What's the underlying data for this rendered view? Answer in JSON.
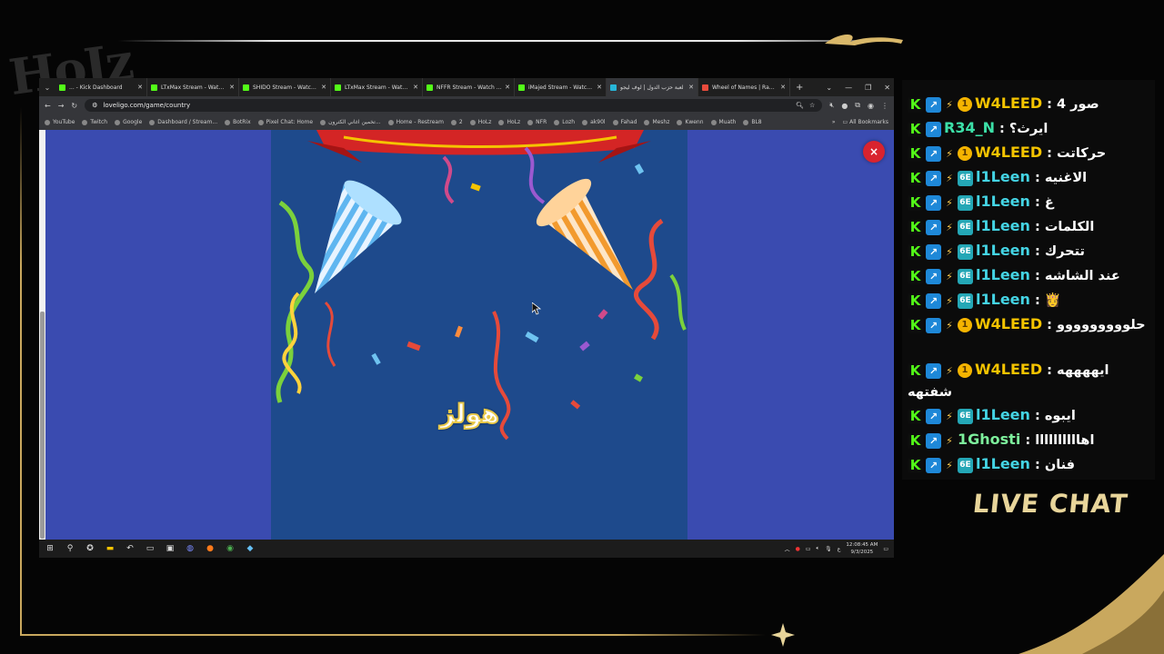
{
  "overlay": {
    "logo_text": "HoIz",
    "live_chat_label": "LIVE CHAT"
  },
  "browser": {
    "tabs": [
      {
        "label": "... - Kick Dashboard",
        "color": "#53fc18"
      },
      {
        "label": "LTxMax Stream - Watch Li",
        "color": "#53fc18"
      },
      {
        "label": "SHIDO Stream - Watch Li",
        "color": "#53fc18"
      },
      {
        "label": "LTxMax Stream - Watch Li",
        "color": "#53fc18"
      },
      {
        "label": "NFFR Stream - Watch Live",
        "color": "#53fc18"
      },
      {
        "label": "iMajed Stream - Watch Li",
        "color": "#53fc18"
      },
      {
        "label": "لعبة حزب الدول | لوف ليجو",
        "color": "#27b6d8",
        "active": true
      },
      {
        "label": "Wheel of Names | Rando",
        "color": "#e94b3c"
      }
    ],
    "url": "loveligo.com/game/country",
    "bookmarks": [
      "YouTube",
      "Twitch",
      "Google",
      "Dashboard / Stream...",
      "BotRix",
      "Pixel Chat: Home",
      "تخمين اغاني الكترون...",
      "Home - Restream",
      "2",
      "HoLz",
      "HoLz",
      "NFR",
      "Lozh",
      "ak90l",
      "Fahad",
      "Meshz",
      "Kwenn",
      "Muath",
      "BL8"
    ],
    "all_bookmarks_label": "All Bookmarks"
  },
  "game": {
    "watermark": "هولز",
    "close_symbol": "×",
    "colors": {
      "sky": "#1e4a8c",
      "side": "#3a4bb0",
      "close": "#d9232e"
    }
  },
  "taskbar": {
    "time": "12:08:45 AM",
    "date": "9/3/2025",
    "lang": "ع"
  },
  "chat": {
    "messages": [
      {
        "user": "W4LEED",
        "badges": [
          "kick",
          "blue",
          "small",
          "coin"
        ],
        "text": "صور 4",
        "ucolor": "#f5c400"
      },
      {
        "user": "R34_N",
        "badges": [
          "kick",
          "blue"
        ],
        "text": "ايرث؟",
        "ucolor": "#3ce0a8"
      },
      {
        "user": "W4LEED",
        "badges": [
          "kick",
          "blue",
          "small",
          "coin"
        ],
        "text": "حركاتت",
        "ucolor": "#f5c400"
      },
      {
        "user": "l1Leen",
        "badges": [
          "kick",
          "blue",
          "small",
          "teal"
        ],
        "text": "الاغنيه",
        "ucolor": "#44d4e4"
      },
      {
        "user": "l1Leen",
        "badges": [
          "kick",
          "blue",
          "small",
          "teal"
        ],
        "text": "غ",
        "ucolor": "#44d4e4"
      },
      {
        "user": "l1Leen",
        "badges": [
          "kick",
          "blue",
          "small",
          "teal"
        ],
        "text": "الكلمات",
        "ucolor": "#44d4e4"
      },
      {
        "user": "l1Leen",
        "badges": [
          "kick",
          "blue",
          "small",
          "teal"
        ],
        "text": "تتحرك",
        "ucolor": "#44d4e4"
      },
      {
        "user": "l1Leen",
        "badges": [
          "kick",
          "blue",
          "small",
          "teal"
        ],
        "text": "عند الشاشه",
        "ucolor": "#44d4e4"
      },
      {
        "user": "l1Leen",
        "badges": [
          "kick",
          "blue",
          "small",
          "teal"
        ],
        "text": "👸",
        "ucolor": "#44d4e4"
      },
      {
        "user": "W4LEED",
        "badges": [
          "kick",
          "blue",
          "small",
          "coin"
        ],
        "text": "حلووووووووو",
        "ucolor": "#f5c400"
      },
      {
        "user": "W4LEED",
        "badges": [
          "kick",
          "blue",
          "small",
          "coin"
        ],
        "text": "ايههههه شفتهه",
        "ucolor": "#f5c400"
      },
      {
        "user": "l1Leen",
        "badges": [
          "kick",
          "blue",
          "small",
          "teal"
        ],
        "text": "ايبوه",
        "ucolor": "#44d4e4"
      },
      {
        "user": "1Ghosti",
        "badges": [
          "kick",
          "blue",
          "small"
        ],
        "text": "اهاااااااااا",
        "ucolor": "#7df09c"
      },
      {
        "user": "l1Leen",
        "badges": [
          "kick",
          "blue",
          "small",
          "teal"
        ],
        "text": "فنان",
        "ucolor": "#44d4e4"
      }
    ]
  }
}
